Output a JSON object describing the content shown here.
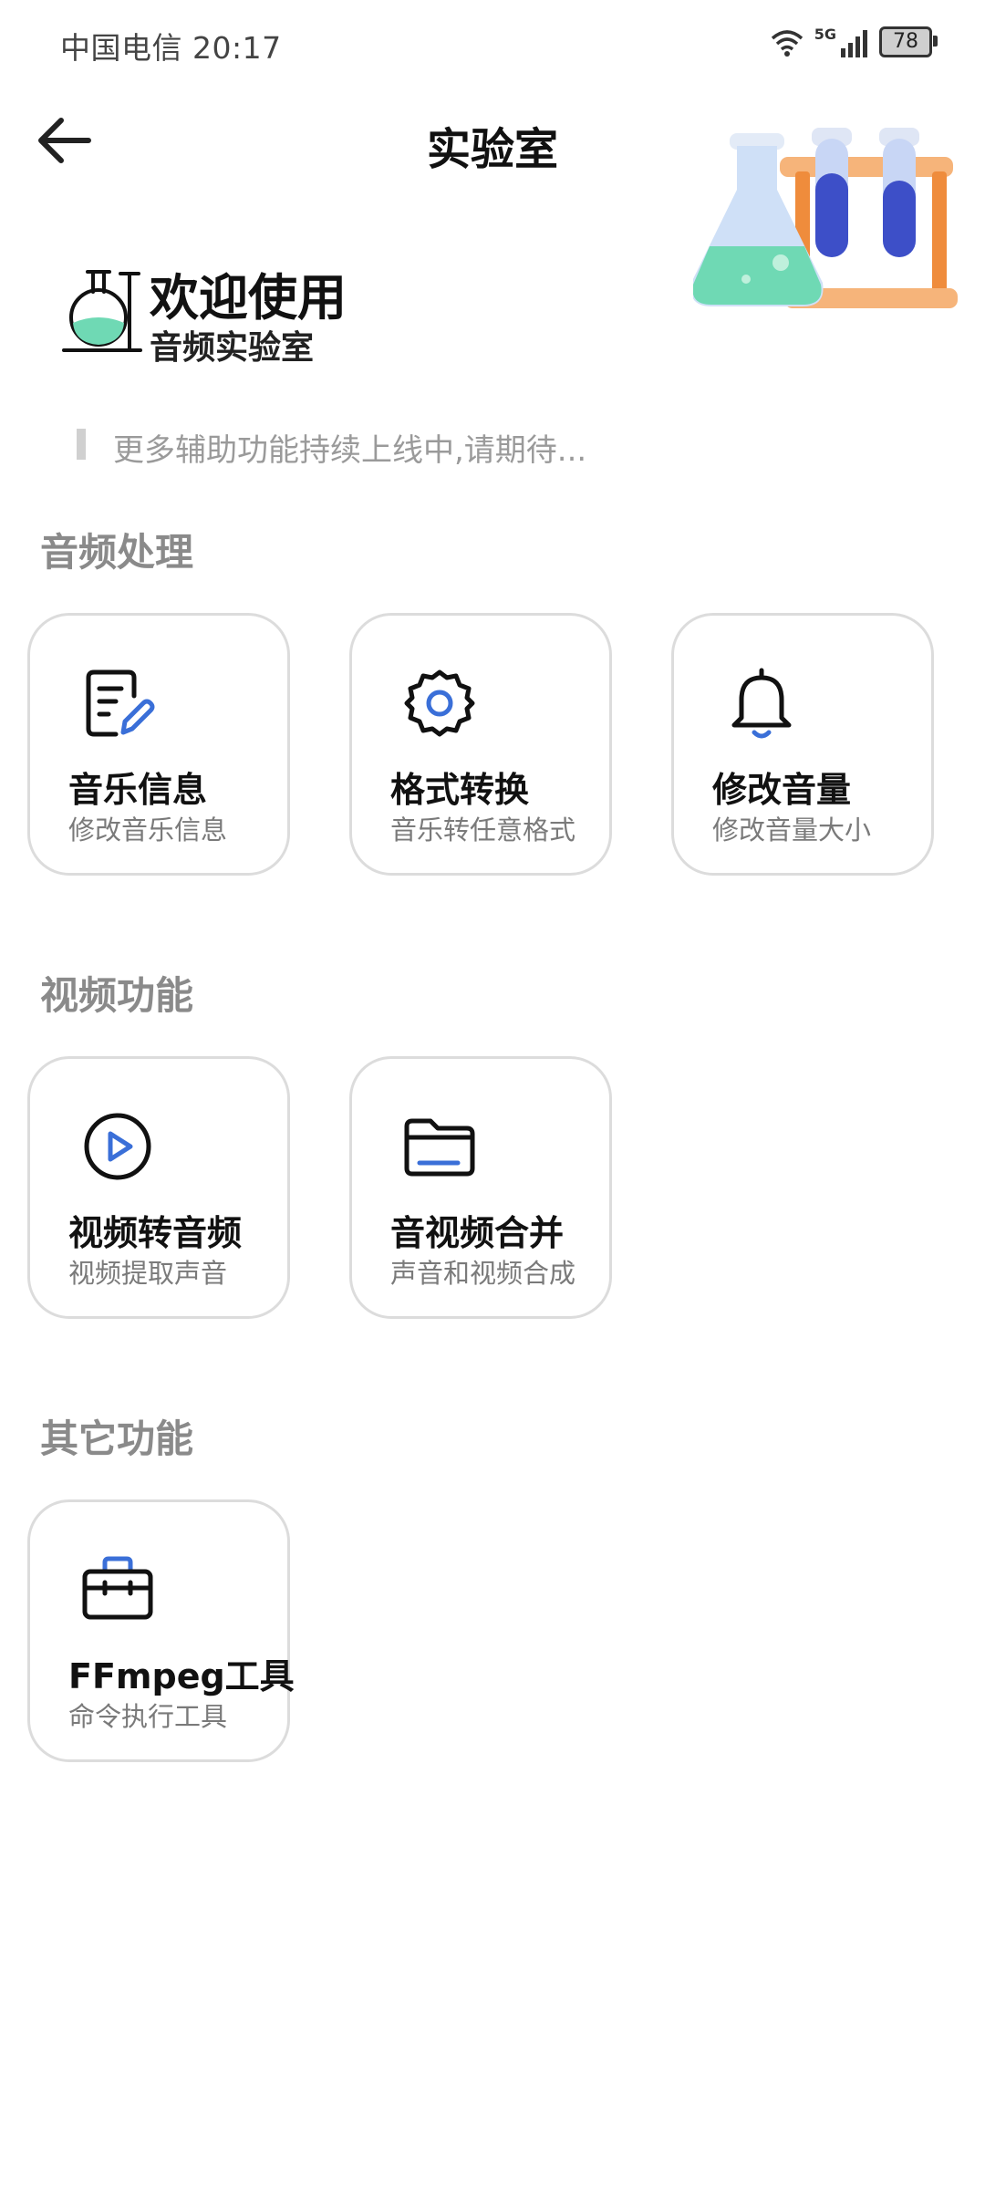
{
  "status_bar": {
    "left_text": "中国电信 20:17",
    "network": "5G",
    "battery": "78"
  },
  "header": {
    "title": "实验室"
  },
  "welcome": {
    "title": "欢迎使用",
    "subtitle": "音频实验室"
  },
  "notice": "更多辅助功能持续上线中,请期待...",
  "sections": [
    {
      "title": "音频处理",
      "cards": [
        {
          "title": "音乐信息",
          "subtitle": "修改音乐信息",
          "icon": "edit-document-icon"
        },
        {
          "title": "格式转换",
          "subtitle": "音乐转任意格式",
          "icon": "gear-icon"
        },
        {
          "title": "修改音量",
          "subtitle": "修改音量大小",
          "icon": "bell-icon"
        }
      ]
    },
    {
      "title": "视频功能",
      "cards": [
        {
          "title": "视频转音频",
          "subtitle": "视频提取声音",
          "icon": "play-circle-icon"
        },
        {
          "title": "音视频合并",
          "subtitle": "声音和视频合成",
          "icon": "folder-icon"
        }
      ]
    },
    {
      "title": "其它功能",
      "cards": [
        {
          "title": "FFmpeg工具",
          "subtitle": "命令执行工具",
          "icon": "toolbox-icon"
        }
      ]
    }
  ],
  "colors": {
    "accent_blue": "#3a6fd8",
    "flask_green": "#6fd9b4",
    "tube_blue": "#3d4fc8",
    "rack_orange": "#f29a4a"
  }
}
